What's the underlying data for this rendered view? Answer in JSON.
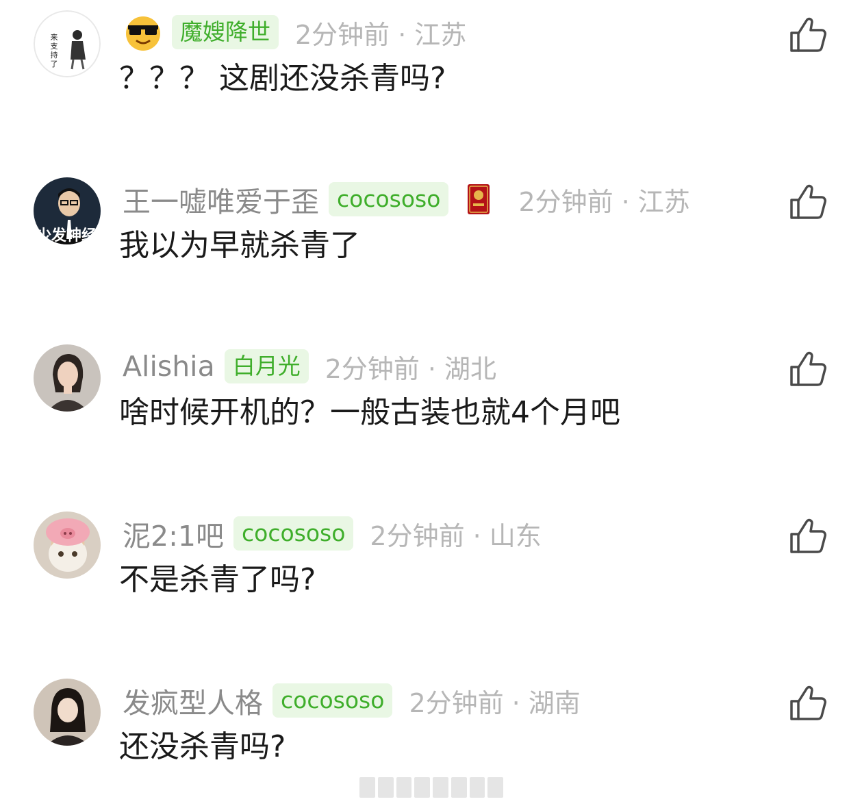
{
  "colors": {
    "username": "#8a8a8a",
    "tag_bg": "#e9f7e4",
    "tag_text": "#3fae2b",
    "meta": "#b6b6b6",
    "content": "#1a1a1a"
  },
  "comments": [
    {
      "avatar": {
        "icon": "avatar-icon",
        "caption": "来支持了"
      },
      "badge_icon": "sunglasses-emoji-icon",
      "username": "",
      "tag": "魔嫂降世",
      "time": "2分钟前",
      "separator": "·",
      "location": "江苏",
      "text": "？？？ 这剧还没杀青吗?"
    },
    {
      "avatar": {
        "icon": "avatar-icon",
        "caption": "少发神经"
      },
      "username": "王一嘘唯爱于歪",
      "tag": "cocososo",
      "medal_icon": "red-medal-icon",
      "time": "2分钟前",
      "separator": "·",
      "location": "江苏",
      "text": "我以为早就杀青了"
    },
    {
      "avatar": {
        "icon": "avatar-icon"
      },
      "username": "Alishia",
      "tag": "白月光",
      "time": "2分钟前",
      "separator": "·",
      "location": "湖北",
      "text": "啥时候开机的？一般古装也就4个月吧"
    },
    {
      "avatar": {
        "icon": "avatar-icon"
      },
      "username": "泥2:1吧",
      "tag": "cocososo",
      "time": "2分钟前",
      "separator": "·",
      "location": "山东",
      "text": "不是杀青了吗?"
    },
    {
      "avatar": {
        "icon": "avatar-icon"
      },
      "username": "发疯型人格",
      "tag": "cocososo",
      "time": "2分钟前",
      "separator": "·",
      "location": "湖南",
      "text": "还没杀青吗?"
    }
  ],
  "like_icon": "thumbs-up-icon"
}
